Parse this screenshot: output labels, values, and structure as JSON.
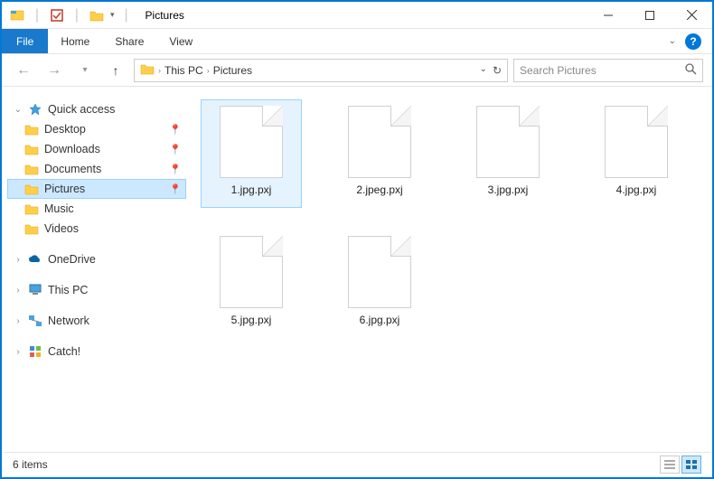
{
  "title": "Pictures",
  "separator": "|",
  "ribbon": {
    "file": "File",
    "tabs": [
      "Home",
      "Share",
      "View"
    ]
  },
  "breadcrumb": {
    "root": "This PC",
    "current": "Pictures"
  },
  "search": {
    "placeholder": "Search Pictures"
  },
  "nav": {
    "quick_access": "Quick access",
    "items": [
      {
        "label": "Desktop",
        "pinned": true
      },
      {
        "label": "Downloads",
        "pinned": true
      },
      {
        "label": "Documents",
        "pinned": true
      },
      {
        "label": "Pictures",
        "pinned": true,
        "selected": true
      },
      {
        "label": "Music",
        "pinned": false
      },
      {
        "label": "Videos",
        "pinned": false
      }
    ],
    "onedrive": "OneDrive",
    "thispc": "This PC",
    "network": "Network",
    "catch": "Catch!"
  },
  "files": [
    {
      "name": "1.jpg.pxj",
      "selected": true
    },
    {
      "name": "2.jpeg.pxj"
    },
    {
      "name": "3.jpg.pxj"
    },
    {
      "name": "4.jpg.pxj"
    },
    {
      "name": "5.jpg.pxj"
    },
    {
      "name": "6.jpg.pxj"
    }
  ],
  "status": "6 items"
}
